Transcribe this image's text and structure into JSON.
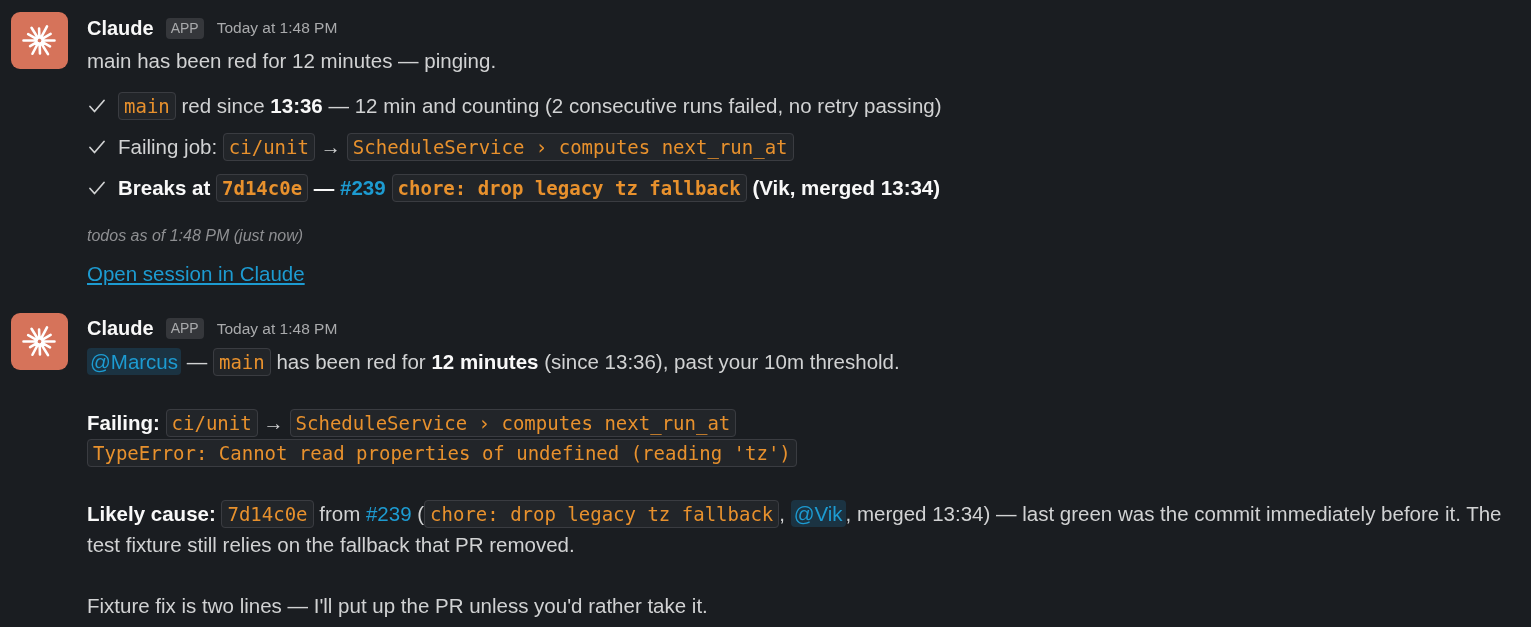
{
  "messages": [
    {
      "sender": "Claude",
      "badge": "APP",
      "time": "Today at 1:48 PM",
      "blocks": [
        {
          "kind": "paragraph",
          "lines": [
            [
              {
                "kind": "text",
                "text": "main has been red for 12 minutes — pinging."
              }
            ]
          ]
        },
        {
          "kind": "checklist",
          "items": [
            {
              "checked": true,
              "bold": false,
              "segments": [
                {
                  "kind": "code",
                  "text": "main"
                },
                {
                  "kind": "text",
                  "text": " red since **13:36** — 12 min and counting (2 consecutive runs failed, no retry passing)"
                }
              ]
            },
            {
              "checked": true,
              "bold": false,
              "segments": [
                {
                  "kind": "text",
                  "text": "Failing job: "
                },
                {
                  "kind": "code",
                  "text": "ci/unit"
                },
                {
                  "kind": "text",
                  "text": " → "
                },
                {
                  "kind": "code",
                  "text": "ScheduleService › computes next_run_at"
                }
              ]
            },
            {
              "checked": true,
              "bold": true,
              "segments": [
                {
                  "kind": "text",
                  "text": "Breaks at "
                },
                {
                  "kind": "code",
                  "text": "7d14c0e"
                },
                {
                  "kind": "text",
                  "text": " — "
                },
                {
                  "kind": "link",
                  "text": "#239"
                },
                {
                  "kind": "code",
                  "text": "chore: drop legacy tz fallback"
                },
                {
                  "kind": "text",
                  "text": " (Vik, merged 13:34)"
                }
              ]
            }
          ]
        },
        {
          "kind": "note",
          "text": "todos as of 1:48 PM (just now)"
        },
        {
          "kind": "link",
          "text": "Open session in Claude"
        }
      ]
    },
    {
      "sender": "Claude",
      "badge": "APP",
      "time": "Today at 1:48 PM",
      "blocks": [
        {
          "kind": "paragraph",
          "lines": [
            [
              {
                "kind": "mention",
                "text": "@Marcus"
              },
              {
                "kind": "text",
                "text": " — "
              },
              {
                "kind": "code",
                "text": "main"
              },
              {
                "kind": "text",
                "text": " has been red for **12 minutes** (since 13:36), past your 10m threshold."
              }
            ]
          ]
        },
        {
          "kind": "paragraph",
          "lines": [
            [
              {
                "kind": "text",
                "text": "**Failing:** "
              },
              {
                "kind": "code",
                "text": "ci/unit"
              },
              {
                "kind": "text",
                "text": " → "
              },
              {
                "kind": "code",
                "text": "ScheduleService › computes next_run_at"
              }
            ],
            [
              {
                "kind": "code",
                "text": "TypeError: Cannot read properties of undefined (reading 'tz')"
              }
            ]
          ]
        },
        {
          "kind": "paragraph",
          "lines": [
            [
              {
                "kind": "text",
                "text": "**Likely cause:** "
              },
              {
                "kind": "code",
                "text": "7d14c0e"
              },
              {
                "kind": "text",
                "text": " from "
              },
              {
                "kind": "link",
                "text": "#239"
              },
              {
                "kind": "text",
                "text": " ("
              },
              {
                "kind": "code",
                "text": "chore: drop legacy tz fallback"
              },
              {
                "kind": "text",
                "text": ", "
              },
              {
                "kind": "mention",
                "text": "@Vik"
              },
              {
                "kind": "text",
                "text": ", merged 13:34) — last green was the commit immediately before it. The test fixture still relies on the fallback that PR removed."
              }
            ]
          ]
        },
        {
          "kind": "paragraph",
          "lines": [
            [
              {
                "kind": "text",
                "text": "Fixture fix is two lines — I'll put up the PR unless you'd rather take it."
              }
            ]
          ]
        }
      ]
    }
  ]
}
